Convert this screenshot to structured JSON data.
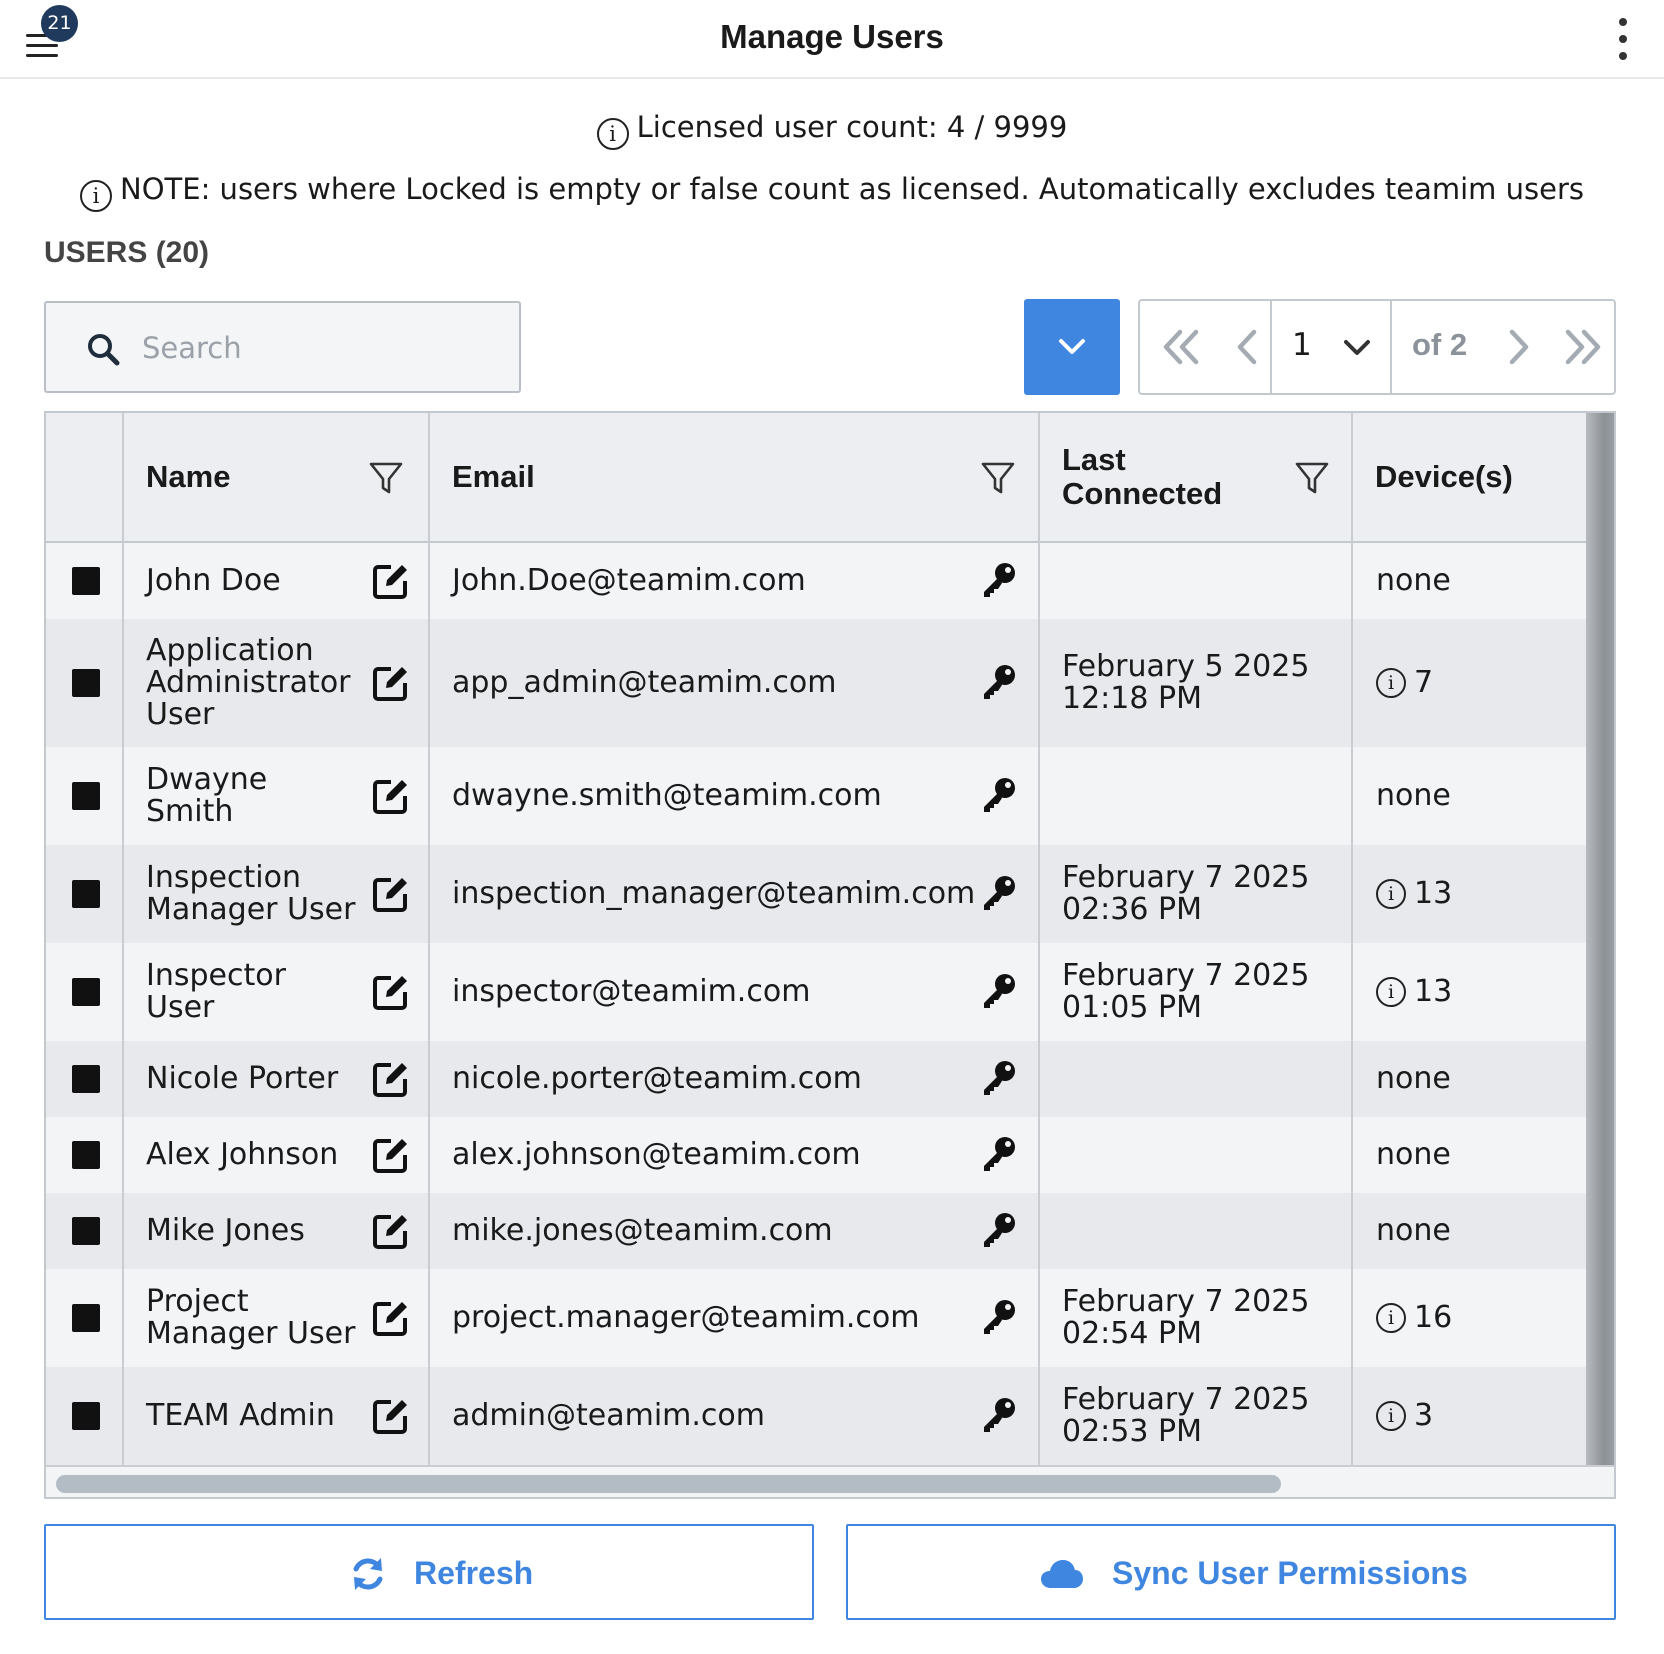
{
  "header": {
    "title": "Manage Users",
    "menu_badge": "21"
  },
  "info": {
    "license_count": "Licensed user count: 4 / 9999",
    "note": "NOTE: users where Locked is empty or false count as licensed. Automatically excludes teamim users",
    "glyph": "i"
  },
  "users_heading": "USERS (20)",
  "search": {
    "placeholder": "Search",
    "value": ""
  },
  "pager": {
    "page": "1",
    "of_label": "of 2"
  },
  "table": {
    "columns": [
      "Name",
      "Email",
      "Last\nConnected",
      "Device(s)"
    ],
    "rows": [
      {
        "name": "John Doe",
        "email": "John.Doe@teamim.com",
        "last": "",
        "devices": "none",
        "dev_info": false
      },
      {
        "name": "Application Administrator User",
        "email": "app_admin@teamim.com",
        "last": "February 5 2025 12:18 PM",
        "devices": "7",
        "dev_info": true
      },
      {
        "name": "Dwayne Smith",
        "email": "dwayne.smith@teamim.com",
        "last": "",
        "devices": "none",
        "dev_info": false
      },
      {
        "name": "Inspection Manager User",
        "email": "inspection_manager@teamim.com",
        "last": "February 7 2025 02:36 PM",
        "devices": "13",
        "dev_info": true
      },
      {
        "name": "Inspector User",
        "email": "inspector@teamim.com",
        "last": "February 7 2025 01:05 PM",
        "devices": "13",
        "dev_info": true
      },
      {
        "name": "Nicole Porter",
        "email": "nicole.porter@teamim.com",
        "last": "",
        "devices": "none",
        "dev_info": false
      },
      {
        "name": "Alex Johnson",
        "email": "alex.johnson@teamim.com",
        "last": "",
        "devices": "none",
        "dev_info": false
      },
      {
        "name": "Mike Jones",
        "email": "mike.jones@teamim.com",
        "last": "",
        "devices": "none",
        "dev_info": false
      },
      {
        "name": "Project Manager User",
        "email": "project.manager@teamim.com",
        "last": "February 7 2025 02:54 PM",
        "devices": "16",
        "dev_info": true
      },
      {
        "name": "TEAM Admin",
        "email": "admin@teamim.com",
        "last": "February 7 2025 02:53 PM",
        "devices": "3",
        "dev_info": true
      }
    ]
  },
  "buttons": {
    "refresh": "Refresh",
    "sync": "Sync User Permissions"
  },
  "colors": {
    "accent": "#3f86e0",
    "badge": "#1f3a5c"
  },
  "icons": [
    "menu-icon",
    "more-vertical-icon",
    "info-icon",
    "search-icon",
    "chevron-down-icon",
    "chevrons-left-icon",
    "chevron-left-icon",
    "chevron-right-icon",
    "chevrons-right-icon",
    "filter-icon",
    "edit-icon",
    "key-icon",
    "refresh-icon",
    "cloud-icon"
  ]
}
